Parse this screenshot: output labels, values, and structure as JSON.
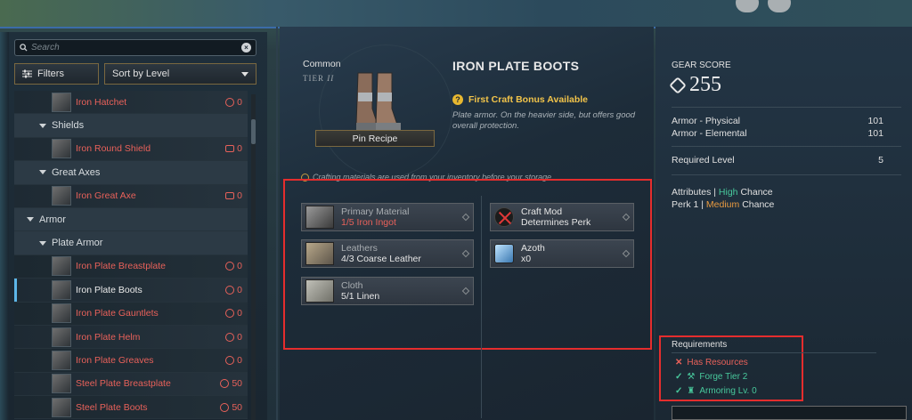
{
  "search": {
    "placeholder": "Search"
  },
  "toolbar": {
    "filters_label": "Filters",
    "sort_label": "Sort by Level"
  },
  "recipe_list": [
    {
      "kind": "item",
      "name": "Iron Hatchet",
      "count": "0",
      "count_icon": "x-circle-icon",
      "selected": false
    },
    {
      "kind": "cat",
      "level": 1,
      "name": "Shields"
    },
    {
      "kind": "item",
      "name": "Iron Round Shield",
      "count": "0",
      "count_icon": "anvil-icon",
      "selected": false
    },
    {
      "kind": "cat",
      "level": 1,
      "name": "Great Axes"
    },
    {
      "kind": "item",
      "name": "Iron Great Axe",
      "count": "0",
      "count_icon": "anvil-icon",
      "selected": false
    },
    {
      "kind": "cat",
      "level": 0,
      "name": "Armor"
    },
    {
      "kind": "cat",
      "level": 1,
      "name": "Plate Armor"
    },
    {
      "kind": "item",
      "name": "Iron Plate Breastplate",
      "count": "0",
      "count_icon": "armor-icon",
      "selected": false
    },
    {
      "kind": "item",
      "name": "Iron Plate Boots",
      "count": "0",
      "count_icon": "armor-icon",
      "selected": true
    },
    {
      "kind": "item",
      "name": "Iron Plate Gauntlets",
      "count": "0",
      "count_icon": "armor-icon",
      "selected": false
    },
    {
      "kind": "item",
      "name": "Iron Plate Helm",
      "count": "0",
      "count_icon": "armor-icon",
      "selected": false
    },
    {
      "kind": "item",
      "name": "Iron Plate Greaves",
      "count": "0",
      "count_icon": "armor-icon",
      "selected": false
    },
    {
      "kind": "item",
      "name": "Steel Plate Breastplate",
      "count": "50",
      "count_icon": "armor-icon",
      "selected": false
    },
    {
      "kind": "item",
      "name": "Steel Plate Boots",
      "count": "50",
      "count_icon": "armor-icon",
      "selected": false
    }
  ],
  "item": {
    "rarity": "Common",
    "tier_text": "TIER",
    "tier_numeral": "II",
    "title": "IRON PLATE BOOTS",
    "pin_label": "Pin Recipe",
    "bonus": "First Craft Bonus Available",
    "description": "Plate armor. On the heavier side, but offers good overall protection."
  },
  "crafting_notice": "Crafting materials are used from your inventory before your storage.",
  "materials": {
    "primary": {
      "label": "Primary Material",
      "have": "1/5",
      "name": "Iron Ingot"
    },
    "leathers": {
      "label": "Leathers",
      "value": "4/3 Coarse Leather"
    },
    "cloth": {
      "label": "Cloth",
      "value": "5/1 Linen"
    },
    "craft_mod": {
      "label": "Craft Mod",
      "value": "Determines Perk"
    },
    "azoth": {
      "label": "Azoth",
      "value": "x0"
    }
  },
  "gear": {
    "label": "GEAR SCORE",
    "score": "255",
    "stats": [
      {
        "name": "Armor - Physical",
        "value": "101"
      },
      {
        "name": "Armor - Elemental",
        "value": "101"
      }
    ],
    "required_level_label": "Required Level",
    "required_level": "5",
    "attributes_label": "Attributes",
    "attributes_chance_level": "High",
    "perk_label": "Perk 1",
    "perk_chance_level": "Medium",
    "chance_word": "Chance"
  },
  "requirements": {
    "title": "Requirements",
    "items": [
      {
        "text": "Has Resources",
        "met": false
      },
      {
        "text": "Forge Tier 2",
        "met": true
      },
      {
        "text": "Armoring Lv. 0",
        "met": true
      }
    ]
  },
  "colors": {
    "accent_red": "#e8615a",
    "accent_green": "#48c89c",
    "accent_gold": "#f2c44a",
    "highlight_box": "#e52d2d"
  }
}
